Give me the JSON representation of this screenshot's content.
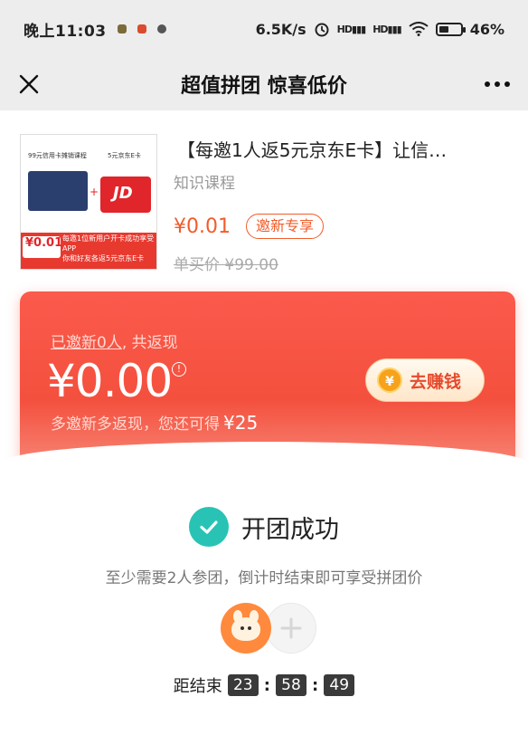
{
  "status_bar": {
    "time": "晚上11:03",
    "speed": "6.5K/s",
    "signal1": "HD",
    "signal2": "HD",
    "battery_percent": "46%",
    "battery_level": 0.46
  },
  "navbar": {
    "title": "超值拼团 惊喜低价"
  },
  "product": {
    "title": "【每邀1人返5元京东E卡】让信…",
    "category": "知识课程",
    "price": "¥0.01",
    "tag": "邀新专享",
    "original_price": "单买价 ¥99.00",
    "thumb": {
      "header_left": "99元信用卡摊销课程",
      "header_right": "5元京东E卡",
      "card_label": "JD",
      "price": "¥0.01",
      "promo_line1": "每邀1位新用户开卡成功享受APP",
      "promo_line2": "你和好友各返5元京东E卡"
    }
  },
  "rebate": {
    "invited_link": "已邀新0人",
    "invited_suffix": ", 共返现",
    "amount": "¥0.00",
    "info_icon": "!",
    "more_text": "多邀新多返现，您还可得",
    "more_value": "¥25",
    "earn_button": "去赚钱",
    "coin_symbol": "¥"
  },
  "group": {
    "status": "开团成功",
    "hint": "至少需要2人参团，倒计时结束即可享受拼团价",
    "countdown_label": "距结束",
    "hours": "23",
    "minutes": "58",
    "seconds": "49",
    "separator": ":"
  },
  "colors": {
    "accent": "#f25c2a",
    "rebate_red": "#f4503e",
    "success_teal": "#28c3b4"
  }
}
